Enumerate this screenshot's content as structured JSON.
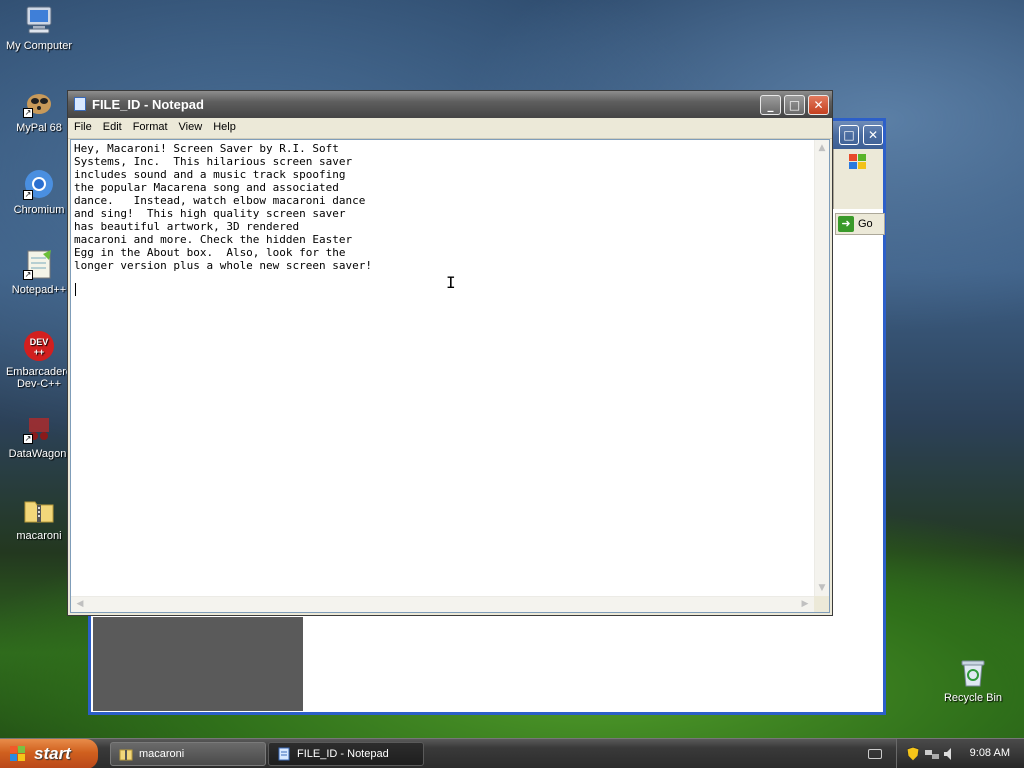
{
  "desktop": {
    "icons": [
      {
        "label": "My Computer",
        "icon": "computer-icon"
      },
      {
        "label": "MyPal 68",
        "icon": "mypal-icon"
      },
      {
        "label": "Chromium",
        "icon": "chromium-icon"
      },
      {
        "label": "Notepad++",
        "icon": "notepadpp-icon"
      },
      {
        "label": "Embarcadero Dev-C++",
        "icon": "devcpp-icon"
      },
      {
        "label": "DataWagon.",
        "icon": "datawagon-icon"
      },
      {
        "label": "macaroni",
        "icon": "folder-zip-icon"
      },
      {
        "label": "Recycle Bin",
        "icon": "recycle-bin-icon"
      }
    ],
    "devcpp_badge": "DEV\n++"
  },
  "background_window": {
    "go_label": "Go"
  },
  "notepad": {
    "title": "FILE_ID - Notepad",
    "menu": [
      "File",
      "Edit",
      "Format",
      "View",
      "Help"
    ],
    "content": "Hey, Macaroni! Screen Saver by R.I. Soft\nSystems, Inc.  This hilarious screen saver\nincludes sound and a music track spoofing\nthe popular Macarena song and associated\ndance.   Instead, watch elbow macaroni dance\nand sing!  This high quality screen saver\nhas beautiful artwork, 3D rendered\nmacaroni and more. Check the hidden Easter\nEgg in the About box.  Also, look for the\nlonger version plus a whole new screen saver!"
  },
  "taskbar": {
    "start_label": "start",
    "buttons": [
      {
        "label": "macaroni",
        "icon": "folder-zip-icon",
        "active": false
      },
      {
        "label": "FILE_ID - Notepad",
        "icon": "notepad-icon",
        "active": true
      }
    ],
    "clock": "9:08 AM"
  },
  "colors": {
    "accent_blue": "#2c5fc9",
    "start_orange": "#d0601e"
  }
}
